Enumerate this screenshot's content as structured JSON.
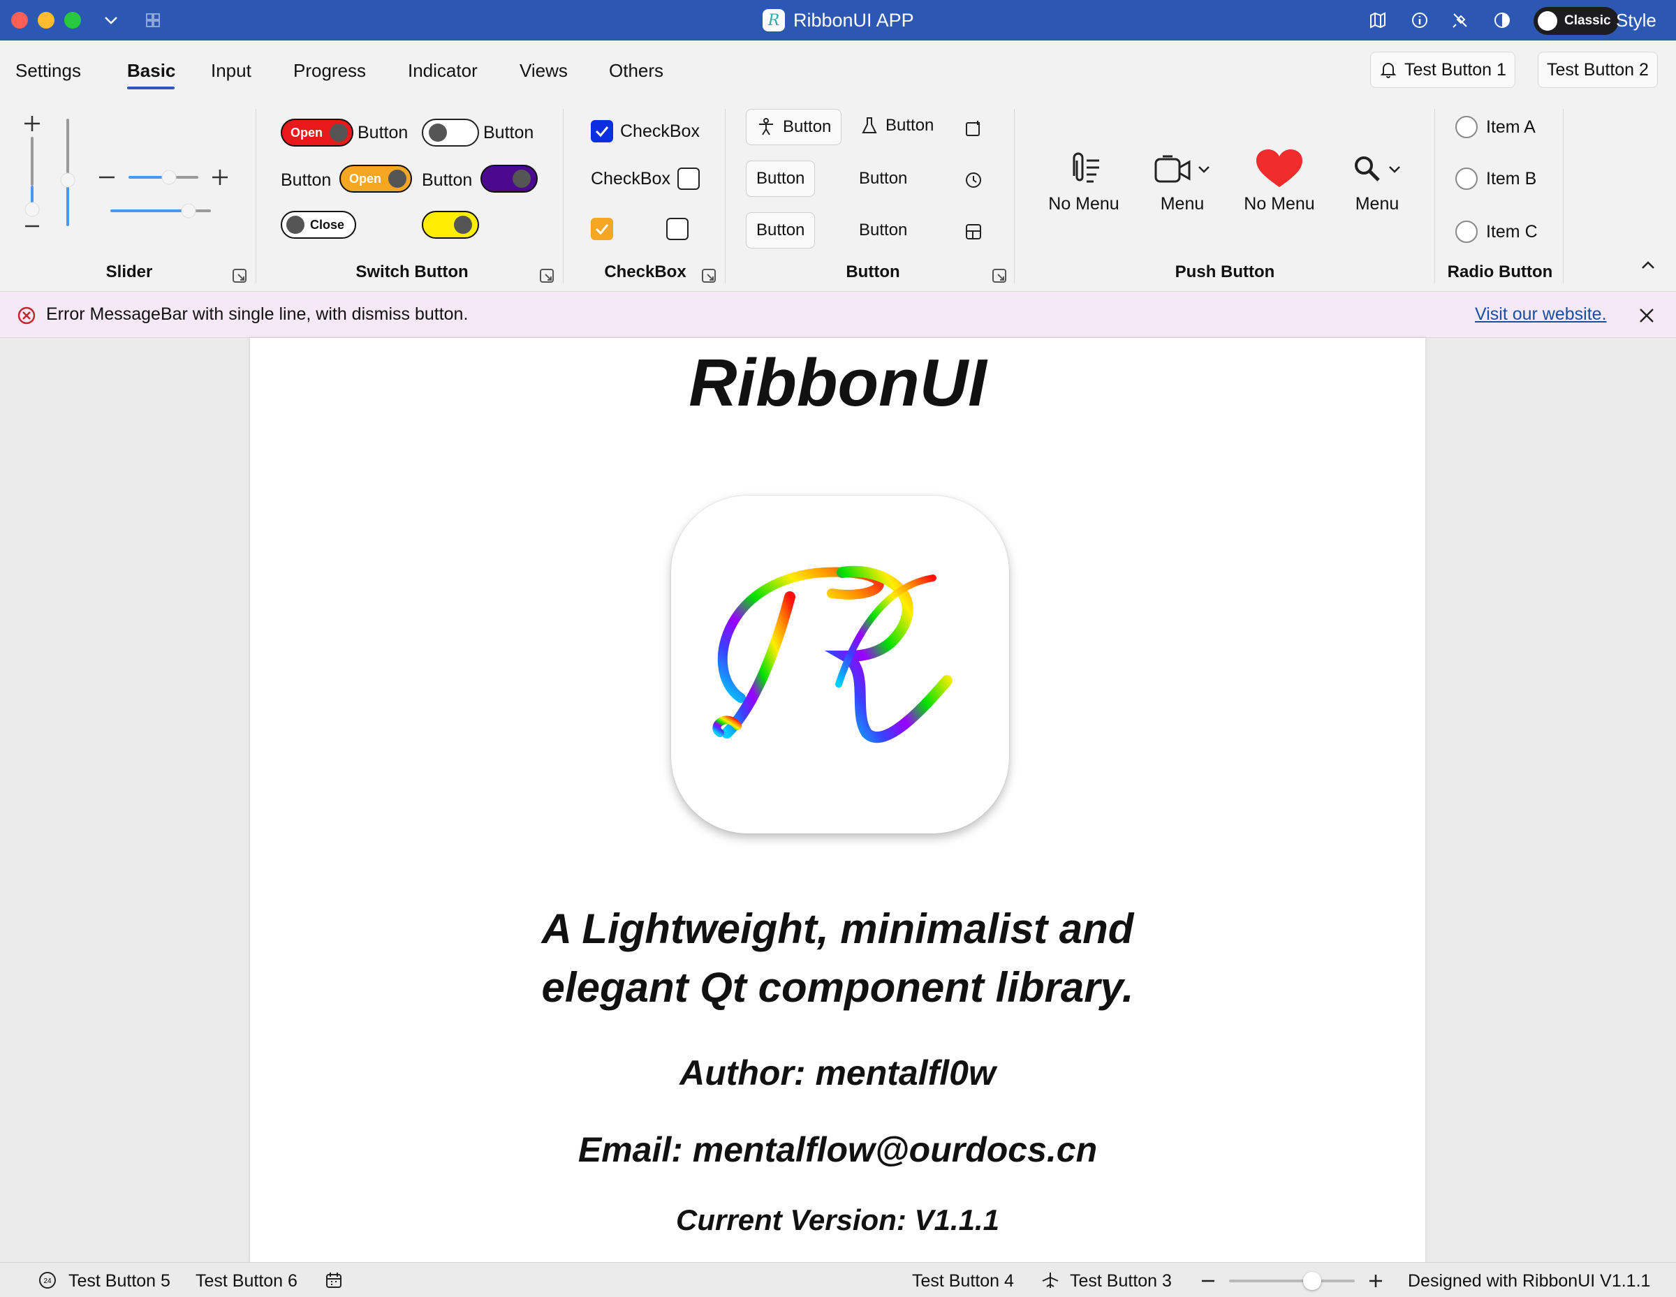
{
  "window": {
    "title": "RibbonUI APP"
  },
  "titlebar": {
    "style_toggle_label": "Classic",
    "style_label": "Style"
  },
  "tabs": [
    "Settings",
    "Basic",
    "Input",
    "Progress",
    "Indicator",
    "Views",
    "Others"
  ],
  "active_tab": "Basic",
  "tab_buttons": [
    "Test Button 1",
    "Test Button 2"
  ],
  "groups": {
    "slider": {
      "label": "Slider"
    },
    "switch": {
      "label": "Switch Button",
      "items": [
        {
          "text": "Open",
          "label": "Button",
          "color": "#e8191a",
          "checked": true
        },
        {
          "text": "",
          "label": "Button",
          "color": "#ffffff",
          "checked": false
        },
        {
          "text": "Open",
          "label": "Button",
          "color": "#f5a623",
          "checked": true
        },
        {
          "text": "",
          "label": "Button",
          "color": "#4b0a8e",
          "checked": true
        },
        {
          "text": "Close",
          "label": "",
          "color": "#ffffff",
          "checked": false
        },
        {
          "text": "",
          "label": "",
          "color": "#ffee00",
          "checked": true
        }
      ]
    },
    "checkbox": {
      "label": "CheckBox",
      "items": [
        {
          "text": "CheckBox",
          "checked": true,
          "color": "#0a2ee0"
        },
        {
          "text": "CheckBox",
          "checked": false
        },
        {
          "text": "",
          "checked": true,
          "color": "#f5a623"
        },
        {
          "text": "",
          "checked": false
        }
      ]
    },
    "button": {
      "label": "Button",
      "items": [
        "Button",
        "Button",
        "Button",
        "Button",
        "Button",
        "Button"
      ]
    },
    "push": {
      "label": "Push Button",
      "items": [
        "No Menu",
        "Menu",
        "No Menu",
        "Menu"
      ]
    },
    "radio": {
      "label": "Radio Button",
      "items": [
        "Item A",
        "Item B",
        "Item C"
      ]
    }
  },
  "messagebar": {
    "text": "Error MessageBar with single line, with dismiss button.",
    "link": "Visit our website."
  },
  "document": {
    "title": "RibbonUI",
    "tagline_1": "A Lightweight, minimalist and",
    "tagline_2": "elegant Qt component library.",
    "author": "Author: mentalfl0w",
    "email": "Email: mentalflow@ourdocs.cn",
    "version": "Current Version: V1.1.1"
  },
  "statusbar": {
    "left": [
      "Test Button 5",
      "Test Button 6"
    ],
    "right": [
      "Test Button 4",
      "Test Button 3"
    ],
    "credit": "Designed with RibbonUI V1.1.1",
    "badge": "24"
  },
  "colors": {
    "accent": "#2c58b3",
    "error": "#c4262e",
    "link": "#1a4ea1"
  }
}
